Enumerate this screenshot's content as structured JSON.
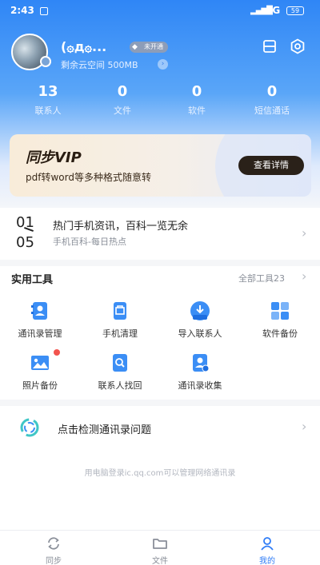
{
  "status_bar": {
    "time": "2:43",
    "network": "4G",
    "battery": "59"
  },
  "profile": {
    "nickname": "(۞д۞...",
    "vip_badge": "未开通",
    "storage": "剩余云空间 500MB"
  },
  "stats": [
    {
      "value": "13",
      "label": "联系人"
    },
    {
      "value": "0",
      "label": "文件"
    },
    {
      "value": "0",
      "label": "软件"
    },
    {
      "value": "0",
      "label": "短信通话"
    }
  ],
  "vip_card": {
    "title": "同步VIP",
    "subtitle": "pdf转word等多种格式随意转",
    "button": "查看详情"
  },
  "news": {
    "month": "01",
    "day": "05",
    "title": "热门手机资讯，百科一览无余",
    "subtitle": "手机百科-每日热点"
  },
  "tools": {
    "title": "实用工具",
    "all_label": "全部工具23",
    "items": [
      {
        "label": "通讯录管理",
        "icon": "contacts-manage-icon"
      },
      {
        "label": "手机清理",
        "icon": "phone-clean-icon"
      },
      {
        "label": "导入联系人",
        "icon": "import-contacts-icon"
      },
      {
        "label": "软件备份",
        "icon": "app-backup-icon"
      },
      {
        "label": "照片备份",
        "icon": "photo-backup-icon"
      },
      {
        "label": "联系人找回",
        "icon": "contacts-recover-icon"
      },
      {
        "label": "通讯录收集",
        "icon": "contacts-collect-icon"
      }
    ]
  },
  "check_row": {
    "label": "点击检测通讯录问题"
  },
  "footer_hint": "用电脑登录ic.qq.com可以管理网络通讯录",
  "tabs": [
    {
      "label": "同步",
      "active": false
    },
    {
      "label": "文件",
      "active": false
    },
    {
      "label": "我的",
      "active": true
    }
  ],
  "colors": {
    "accent": "#2f7cf6",
    "vip_button": "#2a2119",
    "notification_dot": "#f2544e"
  }
}
